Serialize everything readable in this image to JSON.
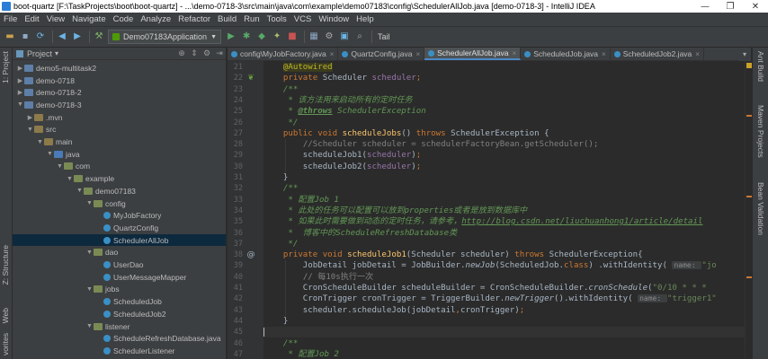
{
  "window": {
    "title": "boot-quartz [F:\\TaskProjects\\boot\\boot-quartz] - ...\\demo-0718-3\\src\\main\\java\\com\\example\\demo07183\\config\\SchedulerAllJob.java [demo-0718-3] - IntelliJ IDEA",
    "controls": [
      "—",
      "❐",
      "✕"
    ]
  },
  "menu": [
    "File",
    "Edit",
    "View",
    "Navigate",
    "Code",
    "Analyze",
    "Refactor",
    "Build",
    "Run",
    "Tools",
    "VCS",
    "Window",
    "Help"
  ],
  "toolbar": {
    "run_config": "Demo07183Application",
    "tail_label": "Tail"
  },
  "left_strip": {
    "project_label": "1: Project",
    "structure_label": "Z: Structure",
    "web_label": "Web",
    "favorites_label": "vorites"
  },
  "project_panel": {
    "title": "Project",
    "tree": [
      {
        "label": "demo5-multitask2",
        "depth": 1,
        "arrow": "▶",
        "icon": "module"
      },
      {
        "label": "demo-0718",
        "depth": 1,
        "arrow": "▶",
        "icon": "module"
      },
      {
        "label": "demo-0718-2",
        "depth": 1,
        "arrow": "▶",
        "icon": "module"
      },
      {
        "label": "demo-0718-3",
        "depth": 1,
        "arrow": "▼",
        "icon": "module"
      },
      {
        "label": ".mvn",
        "depth": 2,
        "arrow": "▶",
        "icon": "folder"
      },
      {
        "label": "src",
        "depth": 2,
        "arrow": "▼",
        "icon": "folder"
      },
      {
        "label": "main",
        "depth": 3,
        "arrow": "▼",
        "icon": "folder"
      },
      {
        "label": "java",
        "depth": 4,
        "arrow": "▼",
        "icon": "src"
      },
      {
        "label": "com",
        "depth": 5,
        "arrow": "▼",
        "icon": "pkg"
      },
      {
        "label": "example",
        "depth": 6,
        "arrow": "▼",
        "icon": "pkg"
      },
      {
        "label": "demo07183",
        "depth": 7,
        "arrow": "▼",
        "icon": "pkg"
      },
      {
        "label": "config",
        "depth": 8,
        "arrow": "▼",
        "icon": "pkg"
      },
      {
        "label": "MyJobFactory",
        "depth": 9,
        "arrow": "",
        "icon": "class"
      },
      {
        "label": "QuartzConfig",
        "depth": 9,
        "arrow": "",
        "icon": "class"
      },
      {
        "label": "SchedulerAllJob",
        "depth": 9,
        "arrow": "",
        "icon": "class",
        "selected": true
      },
      {
        "label": "dao",
        "depth": 8,
        "arrow": "▼",
        "icon": "pkg"
      },
      {
        "label": "UserDao",
        "depth": 9,
        "arrow": "",
        "icon": "class"
      },
      {
        "label": "UserMessageMapper",
        "depth": 9,
        "arrow": "",
        "icon": "class"
      },
      {
        "label": "jobs",
        "depth": 8,
        "arrow": "▼",
        "icon": "pkg"
      },
      {
        "label": "ScheduledJob",
        "depth": 9,
        "arrow": "",
        "icon": "class"
      },
      {
        "label": "ScheduledJob2",
        "depth": 9,
        "arrow": "",
        "icon": "class"
      },
      {
        "label": "listener",
        "depth": 8,
        "arrow": "▼",
        "icon": "pkg"
      },
      {
        "label": "ScheduleRefreshDatabase.java",
        "depth": 9,
        "arrow": "",
        "icon": "class"
      },
      {
        "label": "SchedulerListener",
        "depth": 9,
        "arrow": "",
        "icon": "class"
      }
    ]
  },
  "tabs": [
    {
      "label": "config\\MyJobFactory.java",
      "active": false
    },
    {
      "label": "QuartzConfig.java",
      "active": false
    },
    {
      "label": "SchedulerAllJob.java",
      "active": true
    },
    {
      "label": "ScheduledJob.java",
      "active": false
    },
    {
      "label": "ScheduledJob2.java",
      "active": false
    }
  ],
  "tabs_more": "▾",
  "right_strip": {
    "ant_label": "Ant Build",
    "maven_label": "Maven Projects",
    "bean_label": "Bean Validation"
  },
  "editor": {
    "current_line": 42,
    "lines": [
      {
        "num": "21",
        "gutter": "",
        "tokens": [
          [
            "    ",
            ""
          ],
          [
            "@Autowired",
            "an-box"
          ]
        ]
      },
      {
        "num": "22",
        "gutter": "leaf",
        "tokens": [
          [
            "    ",
            ""
          ],
          [
            "private ",
            "k"
          ],
          [
            "Scheduler ",
            ""
          ],
          [
            "scheduler",
            "f"
          ],
          [
            ";",
            "k"
          ]
        ]
      },
      {
        "num": "23",
        "gutter": "",
        "tokens": [
          [
            "    ",
            ""
          ],
          [
            "/**",
            "d"
          ]
        ]
      },
      {
        "num": "24",
        "gutter": "",
        "tokens": [
          [
            "     * 该方法用来启动所有的定时任务",
            "d"
          ]
        ]
      },
      {
        "num": "25",
        "gutter": "",
        "tokens": [
          [
            "     * ",
            "d"
          ],
          [
            "@throws",
            "dtag"
          ],
          [
            " SchedulerException",
            "d"
          ]
        ]
      },
      {
        "num": "26",
        "gutter": "",
        "tokens": [
          [
            "     */",
            "d"
          ]
        ]
      },
      {
        "num": "27",
        "gutter": "",
        "tokens": [
          [
            "    ",
            ""
          ],
          [
            "public void ",
            "k"
          ],
          [
            "scheduleJobs",
            "m"
          ],
          [
            "() ",
            ""
          ],
          [
            "throws ",
            "k"
          ],
          [
            "SchedulerException {",
            ""
          ]
        ]
      },
      {
        "num": "28",
        "gutter": "",
        "tokens": [
          [
            "        ",
            ""
          ],
          [
            "//Scheduler scheduler = schedulerFactoryBean.getScheduler();",
            "c"
          ]
        ]
      },
      {
        "num": "29",
        "gutter": "",
        "tokens": [
          [
            "        scheduleJob1(",
            ""
          ],
          [
            "scheduler",
            "f"
          ],
          [
            ")",
            ""
          ],
          [
            ";",
            "k"
          ]
        ]
      },
      {
        "num": "30",
        "gutter": "",
        "tokens": [
          [
            "        scheduleJob2(",
            ""
          ],
          [
            "scheduler",
            "f"
          ],
          [
            ")",
            ""
          ],
          [
            ";",
            "k"
          ]
        ]
      },
      {
        "num": "31",
        "gutter": "",
        "tokens": [
          [
            "    }",
            ""
          ]
        ]
      },
      {
        "num": "32",
        "gutter": "",
        "tokens": [
          [
            "    ",
            ""
          ],
          [
            "/**",
            "d"
          ]
        ]
      },
      {
        "num": "33",
        "gutter": "",
        "tokens": [
          [
            "     * 配置",
            "d"
          ],
          [
            "Job 1",
            "d"
          ]
        ]
      },
      {
        "num": "34",
        "gutter": "",
        "tokens": [
          [
            "     * 此处的任务可以配置可以放到",
            "d"
          ],
          [
            "properties",
            "d"
          ],
          [
            "或者是放到数据库中",
            "d"
          ]
        ]
      },
      {
        "num": "35",
        "gutter": "",
        "tokens": [
          [
            "     * 如果此时需要做到动态的定时任务，请参考，",
            "d"
          ],
          [
            "http://blog.csdn.net/liuchuanhong1/article/detail",
            "lk"
          ]
        ]
      },
      {
        "num": "36",
        "gutter": "",
        "tokens": [
          [
            "     *  博客中的",
            "d"
          ],
          [
            "ScheduleRefreshDatabase",
            "d"
          ],
          [
            "类",
            "d"
          ]
        ]
      },
      {
        "num": "37",
        "gutter": "",
        "tokens": [
          [
            "     */",
            "d"
          ]
        ]
      },
      {
        "num": "38",
        "gutter": "at",
        "tokens": [
          [
            "    ",
            ""
          ],
          [
            "private void ",
            "k"
          ],
          [
            "scheduleJob1",
            "m"
          ],
          [
            "(Scheduler scheduler) ",
            ""
          ],
          [
            "throws ",
            "k"
          ],
          [
            "SchedulerException{",
            ""
          ]
        ]
      },
      {
        "num": "39",
        "gutter": "",
        "tokens": [
          [
            "        JobDetail jobDetail = JobBuilder.",
            ""
          ],
          [
            "newJob",
            "im"
          ],
          [
            "(ScheduledJob.",
            ""
          ],
          [
            "class",
            "k"
          ],
          [
            ") .withIdentity( ",
            ""
          ],
          [
            "name: ",
            "hint"
          ],
          [
            "\"jo",
            "s"
          ]
        ]
      },
      {
        "num": "40",
        "gutter": "",
        "tokens": [
          [
            "        ",
            ""
          ],
          [
            "// 每10s执行一次",
            "c"
          ]
        ]
      },
      {
        "num": "41",
        "gutter": "",
        "tokens": [
          [
            "        CronScheduleBuilder scheduleBuilder = CronScheduleBuilder.",
            ""
          ],
          [
            "cronSchedule",
            "im"
          ],
          [
            "(",
            ""
          ],
          [
            "\"0/10 * * *",
            "s"
          ]
        ]
      },
      {
        "num": "42",
        "gutter": "",
        "tokens": [
          [
            "        CronTrigger cronTrigger = TriggerBuilder.",
            ""
          ],
          [
            "newTrigger",
            "im"
          ],
          [
            "().withIdentity( ",
            ""
          ],
          [
            "name: ",
            "hint"
          ],
          [
            "\"trigger1\"",
            "s"
          ]
        ]
      },
      {
        "num": "43",
        "gutter": "",
        "tokens": [
          [
            "        scheduler.scheduleJob(jobDetail",
            ""
          ],
          [
            ",",
            "k"
          ],
          [
            "cronTrigger)",
            ""
          ],
          [
            ";",
            "k"
          ]
        ]
      },
      {
        "num": "44",
        "gutter": "",
        "tokens": [
          [
            "    }",
            ""
          ]
        ]
      },
      {
        "num": "45",
        "gutter": "",
        "tokens": [
          [
            "",
            ""
          ]
        ],
        "cursor": true
      },
      {
        "num": "46",
        "gutter": "",
        "tokens": [
          [
            "    ",
            ""
          ],
          [
            "/**",
            "d"
          ]
        ]
      },
      {
        "num": "47",
        "gutter": "",
        "tokens": [
          [
            "     * 配置",
            "d"
          ],
          [
            "Job 2",
            "d"
          ]
        ]
      }
    ]
  }
}
